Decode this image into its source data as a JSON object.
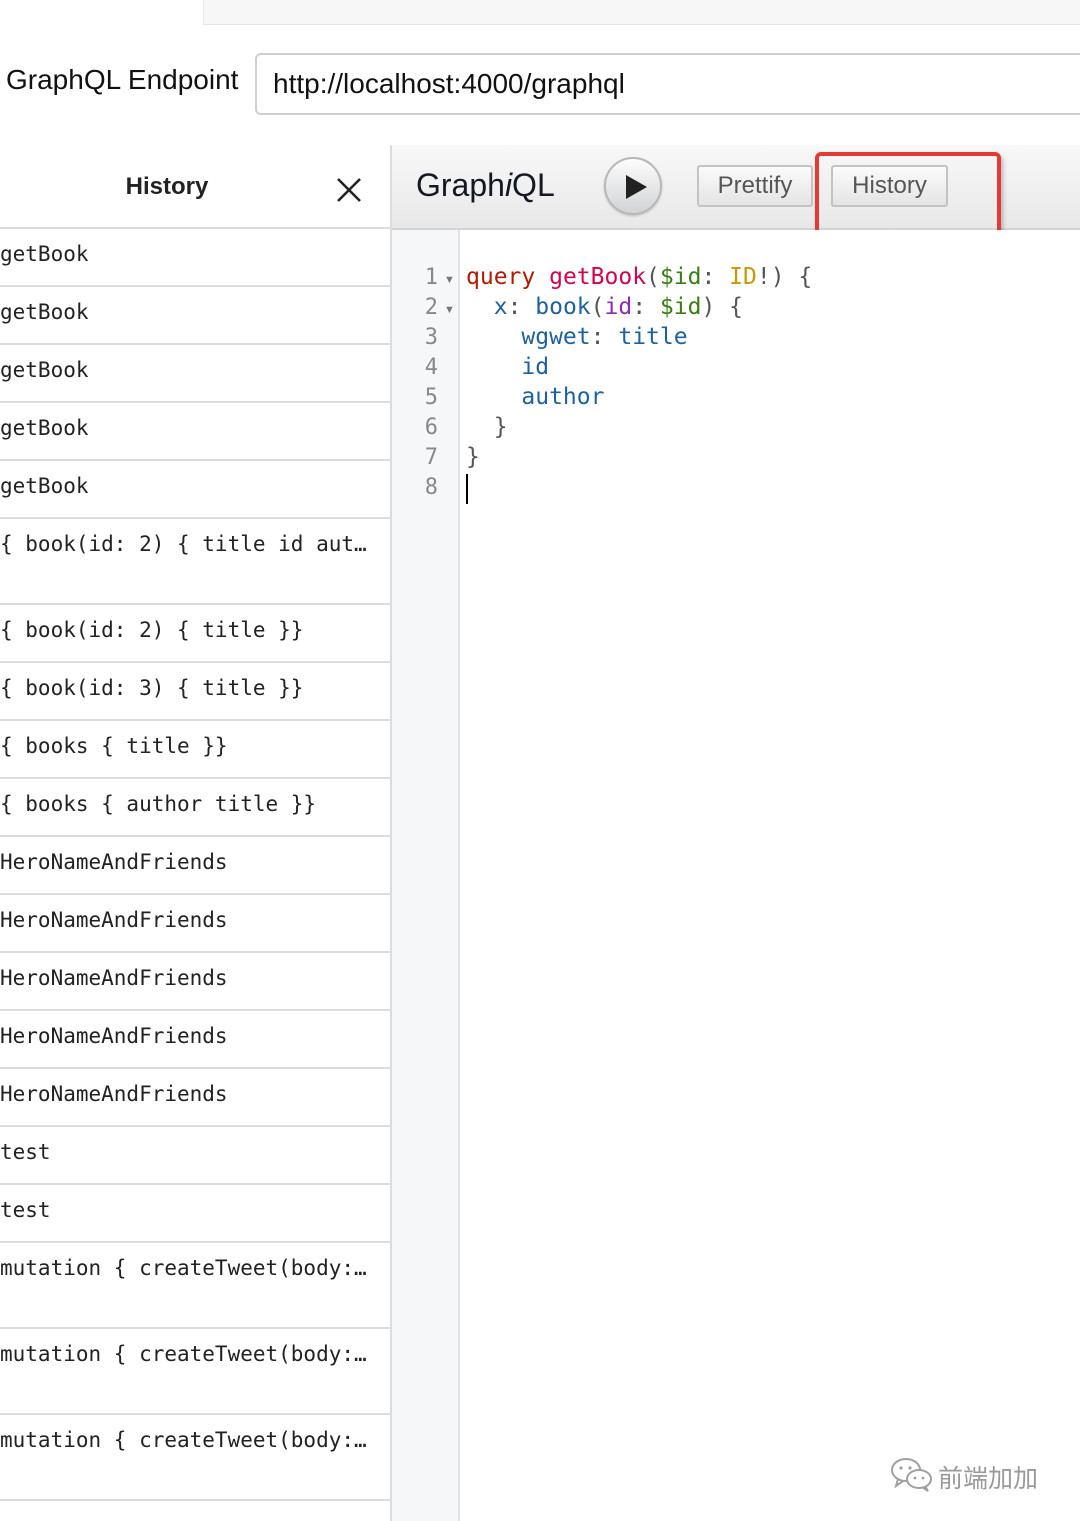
{
  "endpoint": {
    "label": "GraphQL Endpoint",
    "value": "http://localhost:4000/graphql"
  },
  "history_panel": {
    "title": "History",
    "close_icon": "close-icon",
    "items": [
      "getBook",
      "getBook",
      "getBook",
      "getBook",
      "getBook",
      "{ book(id: 2) { title id aut…",
      "{ book(id: 2) { title }}",
      "{ book(id: 3) { title }}",
      "{ books { title }}",
      "{ books { author title }}",
      "HeroNameAndFriends",
      "HeroNameAndFriends",
      "HeroNameAndFriends",
      "HeroNameAndFriends",
      "HeroNameAndFriends",
      "test",
      "test",
      "mutation { createTweet(body:…",
      "mutation { createTweet(body:…",
      "mutation { createTweet(body:…"
    ]
  },
  "toolbar": {
    "title_prefix": "Graph",
    "title_italic": "i",
    "title_suffix": "QL",
    "run_icon": "play-icon",
    "prettify_label": "Prettify",
    "history_label": "History"
  },
  "editor": {
    "line_numbers": [
      "1",
      "2",
      "3",
      "4",
      "5",
      "6",
      "7",
      "8"
    ],
    "tokens": {
      "l1_kw": "query",
      "l1_name": "getBook",
      "l1_open": "(",
      "l1_var": "$id",
      "l1_colon": ": ",
      "l1_type": "ID",
      "l1_close": "!) {",
      "l2_alias": "x",
      "l2_colon": ": ",
      "l2_field": "book",
      "l2_open": "(",
      "l2_arg": "id",
      "l2_argcolon": ": ",
      "l2_var": "$id",
      "l2_close": ") {",
      "l3_alias": "wgwet",
      "l3_colon": ": ",
      "l3_field": "title",
      "l4_field": "id",
      "l5_field": "author",
      "l6_brace": "}",
      "l7_brace": "}"
    }
  },
  "watermark": {
    "icon": "wechat-icon",
    "text": "前端加加"
  }
}
